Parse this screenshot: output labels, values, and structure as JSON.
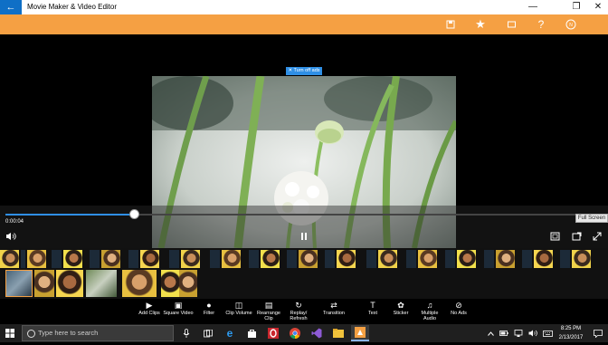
{
  "titlebar": {
    "back_icon": "←",
    "title": "Movie Maker & Video Editor",
    "minimize_icon": "—",
    "maximize_icon": "❐",
    "close_icon": "✕"
  },
  "toolbar": {
    "save_icon": "💾",
    "star_icon": "★",
    "cart_icon": "⬚",
    "help_icon": "?",
    "account_icon": "◎"
  },
  "player": {
    "ad_banner": "✕ Turn off ads",
    "current_time": "0:00:04",
    "progress": 0.215,
    "fullscreen_tooltip": "Full Screen",
    "volume_icon": "🔊",
    "pause_icon": "⏸",
    "crop_icon": "▣",
    "cast_icon": "⇱",
    "expand_icon": "⤢"
  },
  "actions": [
    {
      "icon": "▶",
      "label": "Add Clips"
    },
    {
      "icon": "▣",
      "label": "Square Video"
    },
    {
      "icon": "●",
      "label": "Filter"
    },
    {
      "icon": "◫",
      "label": "Clip Volume"
    },
    {
      "icon": "▤",
      "label": "Rearrange Clip"
    },
    {
      "icon": "↻",
      "label": "Replay/ Refresh"
    },
    {
      "icon": "⇄",
      "label": "Transition"
    },
    {
      "icon": "T",
      "label": "Text"
    },
    {
      "icon": "✿",
      "label": "Sticker"
    },
    {
      "icon": "♫",
      "label": "Multiple Audio"
    },
    {
      "icon": "⊘",
      "label": "No Ads"
    }
  ],
  "taskbar": {
    "start_icon": "⊞",
    "search_icon": "○",
    "search_placeholder": "Type here to search",
    "time": "8:25 PM",
    "date": "2/13/2017"
  },
  "colors": {
    "accent": "#f5a043",
    "brand_blue": "#0f6fc6",
    "progress_blue": "#2f8fe5"
  }
}
